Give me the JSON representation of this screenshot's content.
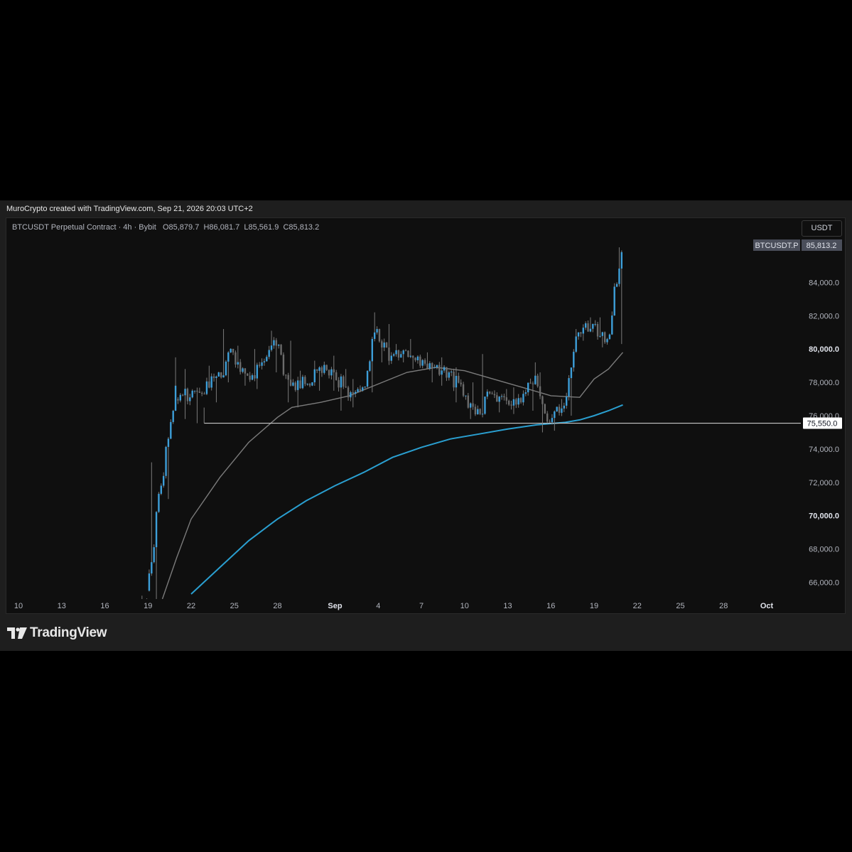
{
  "attribution": "MuroCrypto created with TradingView.com, Sep 21, 2026 20:03 UTC+2",
  "symbol": {
    "name": "BTCUSDT Perpetual Contract · 4h · Bybit",
    "open_label": "O",
    "open": "85,879.7",
    "high_label": "H",
    "high": "86,081.7",
    "low_label": "L",
    "low": "85,561.9",
    "close_label": "C",
    "close": "85,813.2"
  },
  "currency": "USDT",
  "price_tag": {
    "ticker": "BTCUSDT.P",
    "value": "85,813.2"
  },
  "brand": "TradingView",
  "colors": {
    "background": "#0f0f0f",
    "candle": "#3d9fd9",
    "wick": "#7a7a7a",
    "ma_fast": "#7b7b7b",
    "ma_slow": "#2a9fd0",
    "support_line": "#c8c8c8",
    "axis_text": "#b2b5be"
  },
  "chart_data": {
    "type": "candlestick",
    "interval": "4h",
    "y_axis": {
      "min": 65000,
      "max": 87000,
      "ticks": [
        "66,000.0",
        "68,000.0",
        "70,000.0",
        "72,000.0",
        "74,000.0",
        "76,000.0",
        "78,000.0",
        "80,000.0",
        "82,000.0",
        "84,000.0"
      ],
      "bold_ticks": [
        "70,000.0",
        "80,000.0"
      ]
    },
    "x_axis": {
      "ticks": [
        "10",
        "13",
        "16",
        "19",
        "22",
        "25",
        "28",
        "Sep",
        "4",
        "7",
        "10",
        "13",
        "16",
        "19",
        "22",
        "25",
        "28",
        "Oct"
      ],
      "range_days": [
        "Aug 10",
        "Oct 1"
      ]
    },
    "support_level": {
      "value": 75550,
      "label": "75,550.0",
      "from": "Aug 23",
      "to": "right edge"
    },
    "last_price": 85813.2,
    "candles_daily_approx": [
      {
        "date": "Aug 19",
        "o": 64000,
        "h": 65200,
        "l": 63500,
        "c": 65000
      },
      {
        "date": "Aug 20",
        "o": 65500,
        "h": 73200,
        "l": 65000,
        "c": 71800
      },
      {
        "date": "Aug 21",
        "o": 71800,
        "h": 79500,
        "l": 71000,
        "c": 77800
      },
      {
        "date": "Aug 22",
        "o": 77000,
        "h": 78800,
        "l": 75800,
        "c": 77100
      },
      {
        "date": "Aug 23",
        "o": 77100,
        "h": 77500,
        "l": 75550,
        "c": 77300
      },
      {
        "date": "Aug 24",
        "o": 77300,
        "h": 79000,
        "l": 76800,
        "c": 78600
      },
      {
        "date": "Aug 25",
        "o": 78600,
        "h": 81200,
        "l": 78000,
        "c": 79800
      },
      {
        "date": "Aug 26",
        "o": 79800,
        "h": 80200,
        "l": 77800,
        "c": 78400
      },
      {
        "date": "Aug 27",
        "o": 78400,
        "h": 80000,
        "l": 77600,
        "c": 79200
      },
      {
        "date": "Aug 28",
        "o": 79200,
        "h": 81100,
        "l": 78600,
        "c": 80200
      },
      {
        "date": "Aug 29",
        "o": 80200,
        "h": 80500,
        "l": 76800,
        "c": 77800
      },
      {
        "date": "Aug 30",
        "o": 77800,
        "h": 78700,
        "l": 76500,
        "c": 77900
      },
      {
        "date": "Aug 31",
        "o": 77900,
        "h": 79300,
        "l": 77500,
        "c": 78900
      },
      {
        "date": "Sep 1",
        "o": 78900,
        "h": 79600,
        "l": 77500,
        "c": 78600
      },
      {
        "date": "Sep 2",
        "o": 78600,
        "h": 78800,
        "l": 76300,
        "c": 77100
      },
      {
        "date": "Sep 3",
        "o": 77100,
        "h": 78200,
        "l": 76500,
        "c": 77700
      },
      {
        "date": "Sep 4",
        "o": 77700,
        "h": 82200,
        "l": 77400,
        "c": 81200
      },
      {
        "date": "Sep 5",
        "o": 81200,
        "h": 81500,
        "l": 79200,
        "c": 79600
      },
      {
        "date": "Sep 6",
        "o": 79600,
        "h": 80300,
        "l": 79200,
        "c": 79900
      },
      {
        "date": "Sep 7",
        "o": 79900,
        "h": 80600,
        "l": 78800,
        "c": 79000
      },
      {
        "date": "Sep 8",
        "o": 79000,
        "h": 79800,
        "l": 78000,
        "c": 78900
      },
      {
        "date": "Sep 9",
        "o": 78900,
        "h": 79500,
        "l": 77800,
        "c": 78600
      },
      {
        "date": "Sep 10",
        "o": 78600,
        "h": 78900,
        "l": 76800,
        "c": 77200
      },
      {
        "date": "Sep 11",
        "o": 77200,
        "h": 78000,
        "l": 75800,
        "c": 76400
      },
      {
        "date": "Sep 12",
        "o": 76400,
        "h": 79700,
        "l": 75900,
        "c": 77300
      },
      {
        "date": "Sep 13",
        "o": 77300,
        "h": 77600,
        "l": 76200,
        "c": 76900
      },
      {
        "date": "Sep 14",
        "o": 76900,
        "h": 77700,
        "l": 76100,
        "c": 76800
      },
      {
        "date": "Sep 15",
        "o": 76800,
        "h": 79200,
        "l": 76300,
        "c": 78400
      },
      {
        "date": "Sep 16",
        "o": 78400,
        "h": 78600,
        "l": 75000,
        "c": 75600
      },
      {
        "date": "Sep 17",
        "o": 75600,
        "h": 77000,
        "l": 75100,
        "c": 76600
      },
      {
        "date": "Sep 18",
        "o": 76600,
        "h": 81200,
        "l": 76000,
        "c": 81000
      },
      {
        "date": "Sep 19",
        "o": 81000,
        "h": 81900,
        "l": 80500,
        "c": 81500
      },
      {
        "date": "Sep 20",
        "o": 81500,
        "h": 81900,
        "l": 80100,
        "c": 80600
      },
      {
        "date": "Sep 21",
        "o": 80600,
        "h": 86100,
        "l": 80300,
        "c": 85813.2
      }
    ],
    "series": [
      {
        "name": "MA fast",
        "color": "#7b7b7b",
        "points": [
          [
            "Aug 20",
            65000
          ],
          [
            "Aug 21",
            67500
          ],
          [
            "Aug 22",
            69800
          ],
          [
            "Aug 24",
            72300
          ],
          [
            "Aug 26",
            74400
          ],
          [
            "Aug 28",
            75900
          ],
          [
            "Aug 29",
            76500
          ],
          [
            "Aug 31",
            76800
          ],
          [
            "Sep 2",
            77200
          ],
          [
            "Sep 4",
            77900
          ],
          [
            "Sep 6",
            78600
          ],
          [
            "Sep 8",
            78900
          ],
          [
            "Sep 10",
            78700
          ],
          [
            "Sep 12",
            78200
          ],
          [
            "Sep 14",
            77700
          ],
          [
            "Sep 16",
            77200
          ],
          [
            "Sep 18",
            77100
          ],
          [
            "Sep 19",
            78200
          ],
          [
            "Sep 20",
            78800
          ],
          [
            "Sep 21",
            79800
          ]
        ]
      },
      {
        "name": "MA slow",
        "color": "#2a9fd0",
        "points": [
          [
            "Aug 22",
            65300
          ],
          [
            "Aug 24",
            66900
          ],
          [
            "Aug 26",
            68500
          ],
          [
            "Aug 28",
            69800
          ],
          [
            "Aug 30",
            70900
          ],
          [
            "Sep 1",
            71800
          ],
          [
            "Sep 3",
            72600
          ],
          [
            "Sep 5",
            73500
          ],
          [
            "Sep 7",
            74100
          ],
          [
            "Sep 9",
            74600
          ],
          [
            "Sep 11",
            74900
          ],
          [
            "Sep 13",
            75200
          ],
          [
            "Sep 15",
            75450
          ],
          [
            "Sep 17",
            75600
          ],
          [
            "Sep 18",
            75750
          ],
          [
            "Sep 19",
            76000
          ],
          [
            "Sep 20",
            76300
          ],
          [
            "Sep 21",
            76650
          ]
        ]
      }
    ]
  }
}
